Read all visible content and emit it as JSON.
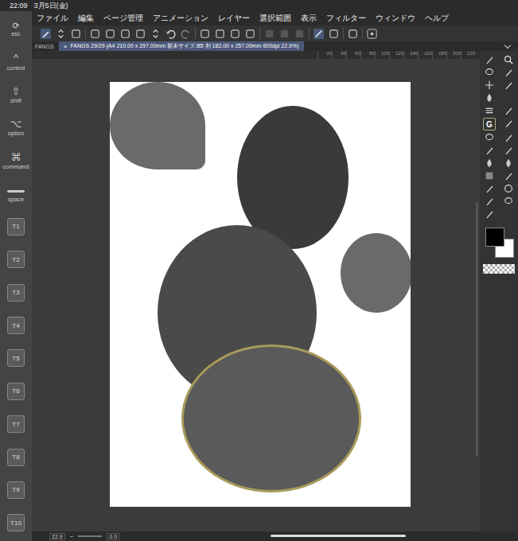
{
  "status": {
    "time": "22:09",
    "date": "3月5日(金)"
  },
  "menu": [
    "ファイル",
    "編集",
    "ページ管理",
    "アニメーション",
    "レイヤー",
    "選択範囲",
    "表示",
    "フィルター",
    "ウィンドウ",
    "ヘルプ"
  ],
  "keys": [
    {
      "label": "esc",
      "kind": "esc",
      "glyph": "⟳"
    },
    {
      "label": "control",
      "kind": "glyph",
      "glyph": "^"
    },
    {
      "label": "shift",
      "kind": "glyph",
      "glyph": "⇧"
    },
    {
      "label": "option",
      "kind": "glyph",
      "glyph": "⌥"
    },
    {
      "label": "command",
      "kind": "glyph",
      "glyph": "⌘"
    },
    {
      "label": "space",
      "kind": "bar",
      "glyph": "—"
    }
  ],
  "tool_keys": [
    "T1",
    "T2",
    "T3",
    "T4",
    "T5",
    "T6",
    "T7",
    "T8",
    "T9",
    "T10"
  ],
  "panel_label": "FANGS",
  "tab": {
    "close": "×",
    "title": "FANGS 29/29 (A4 210.00 x 297.00mm 製本サイズ:B5 判 182.00 x 257.00mm 600dpi 22.9%)",
    "selected": true
  },
  "ruler": [
    "20",
    "40",
    "60",
    "80",
    "100",
    "120",
    "140",
    "160",
    "180",
    "200",
    "220"
  ],
  "palette_letter": "G",
  "colors": {
    "main": "#000000",
    "sub": "#ffffff"
  },
  "bottom": {
    "zoom": "22.9",
    "angle": "0.0"
  }
}
